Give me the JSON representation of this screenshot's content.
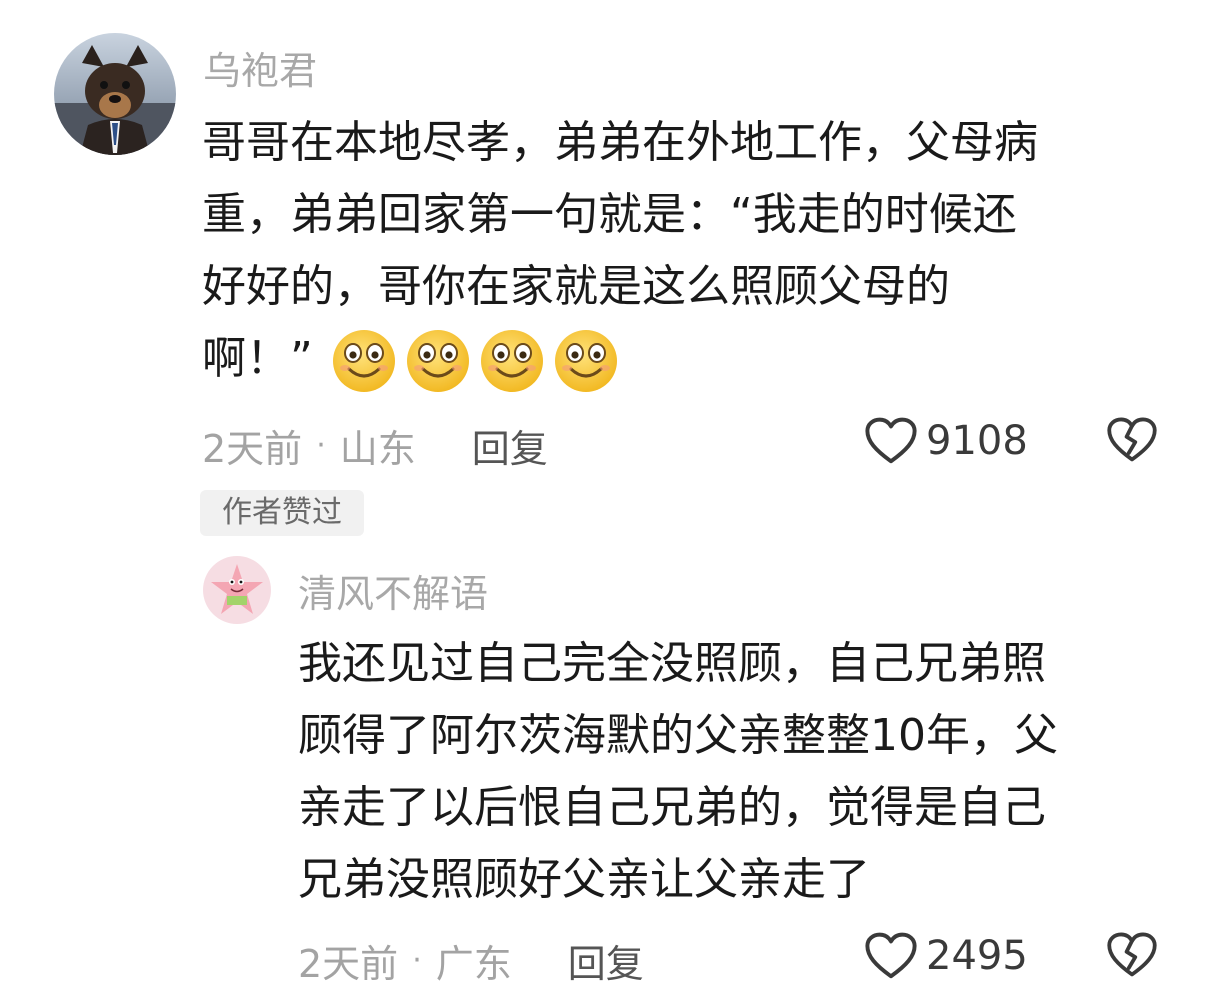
{
  "comment1": {
    "username": "乌袍君",
    "lines": [
      "哥哥在本地尽孝，弟弟在外地工作，父母病",
      "重，弟弟回家第一句就是：“我走的时候还",
      "好好的，哥你在家就是这么照顾父母的",
      "啊！”"
    ],
    "emoji_icon": "smiling-face-icon",
    "time": "2天前",
    "separator": "·",
    "location": "山东",
    "reply_label": "回复",
    "like_count": "9108",
    "badge": "作者赞过"
  },
  "comment2": {
    "username": "清风不解语",
    "lines": [
      "我还见过自己完全没照顾，自己兄弟照",
      "顾得了阿尔茨海默的父亲整整10年，父",
      "亲走了以后恨自己兄弟的，觉得是自己",
      "兄弟没照顾好父亲让父亲走了"
    ],
    "time": "2天前",
    "separator": "·",
    "location": "广东",
    "reply_label": "回复",
    "like_count": "2495"
  },
  "colors": {
    "meta_gray": "#a3a3a3",
    "emoji_yellow": "#f7c944"
  }
}
